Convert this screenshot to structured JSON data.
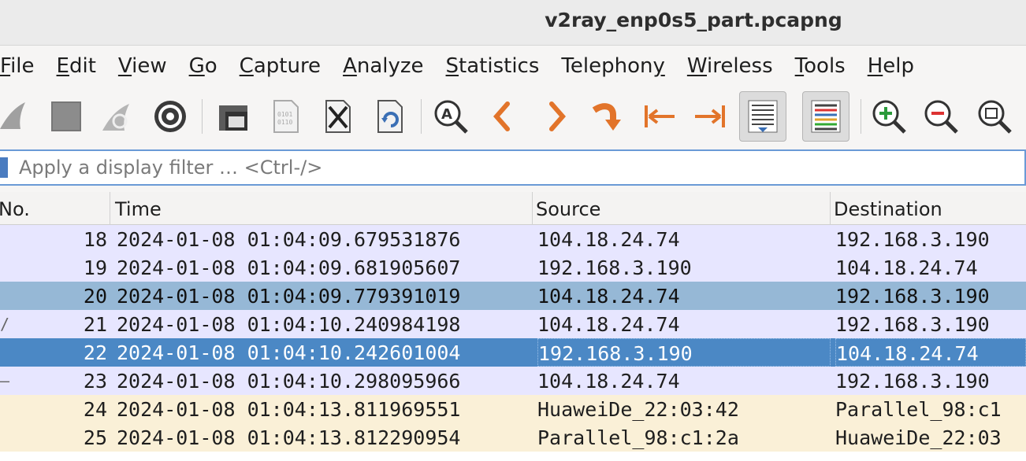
{
  "window": {
    "title": "v2ray_enp0s5_part.pcapng"
  },
  "menu": [
    {
      "pre": "",
      "u": "F",
      "post": "ile"
    },
    {
      "pre": "",
      "u": "E",
      "post": "dit"
    },
    {
      "pre": "",
      "u": "V",
      "post": "iew"
    },
    {
      "pre": "",
      "u": "G",
      "post": "o"
    },
    {
      "pre": "",
      "u": "C",
      "post": "apture"
    },
    {
      "pre": "",
      "u": "A",
      "post": "nalyze"
    },
    {
      "pre": "",
      "u": "S",
      "post": "tatistics"
    },
    {
      "pre": "Telephon",
      "u": "y",
      "post": ""
    },
    {
      "pre": "",
      "u": "W",
      "post": "ireless"
    },
    {
      "pre": "",
      "u": "T",
      "post": "ools"
    },
    {
      "pre": "",
      "u": "H",
      "post": "elp"
    }
  ],
  "toolbar": {
    "icons": [
      "shark-fin-start-icon",
      "stop-square-icon",
      "restart-fin-icon",
      "capture-options-gear-icon",
      "open-folder-icon",
      "file-binary-icon",
      "close-file-icon",
      "reload-file-icon",
      "find-packet-icon",
      "go-back-icon",
      "go-forward-icon",
      "go-to-packet-icon",
      "first-packet-icon",
      "last-packet-icon",
      "autoscroll-icon",
      "colorize-icon",
      "zoom-in-icon",
      "zoom-out-icon",
      "normal-size-icon"
    ]
  },
  "filter": {
    "placeholder": "Apply a display filter … <Ctrl-/>"
  },
  "columns": {
    "no": "No.",
    "time": "Time",
    "source": "Source",
    "destination": "Destination"
  },
  "colors": {
    "tcp_row": "#e7e6ff",
    "arp_row": "#faf0d7",
    "selected": "#4b88c5",
    "highlight": "#96b8d6"
  },
  "packets": [
    {
      "no": "18",
      "time": "2024-01-08 01:04:09.679531876",
      "source": "104.18.24.74",
      "destination": "192.168.3.190",
      "style": "tcp",
      "marker": ""
    },
    {
      "no": "19",
      "time": "2024-01-08 01:04:09.681905607",
      "source": "192.168.3.190",
      "destination": "104.18.24.74",
      "style": "tcp",
      "marker": ""
    },
    {
      "no": "20",
      "time": "2024-01-08 01:04:09.779391019",
      "source": "104.18.24.74",
      "destination": "192.168.3.190",
      "style": "highlight",
      "marker": ""
    },
    {
      "no": "21",
      "time": "2024-01-08 01:04:10.240984198",
      "source": "104.18.24.74",
      "destination": "192.168.3.190",
      "style": "tcp",
      "marker": "/"
    },
    {
      "no": "22",
      "time": "2024-01-08 01:04:10.242601004",
      "source": "192.168.3.190",
      "destination": "104.18.24.74",
      "style": "selected",
      "marker": ""
    },
    {
      "no": "23",
      "time": "2024-01-08 01:04:10.298095966",
      "source": "104.18.24.74",
      "destination": "192.168.3.190",
      "style": "tcp",
      "marker": "—"
    },
    {
      "no": "24",
      "time": "2024-01-08 01:04:13.811969551",
      "source": "HuaweiDe_22:03:42",
      "destination": "Parallel_98:c1",
      "style": "arp",
      "marker": ""
    },
    {
      "no": "25",
      "time": "2024-01-08 01:04:13.812290954",
      "source": "Parallel_98:c1:2a",
      "destination": "HuaweiDe_22:03",
      "style": "arp",
      "marker": ""
    }
  ]
}
